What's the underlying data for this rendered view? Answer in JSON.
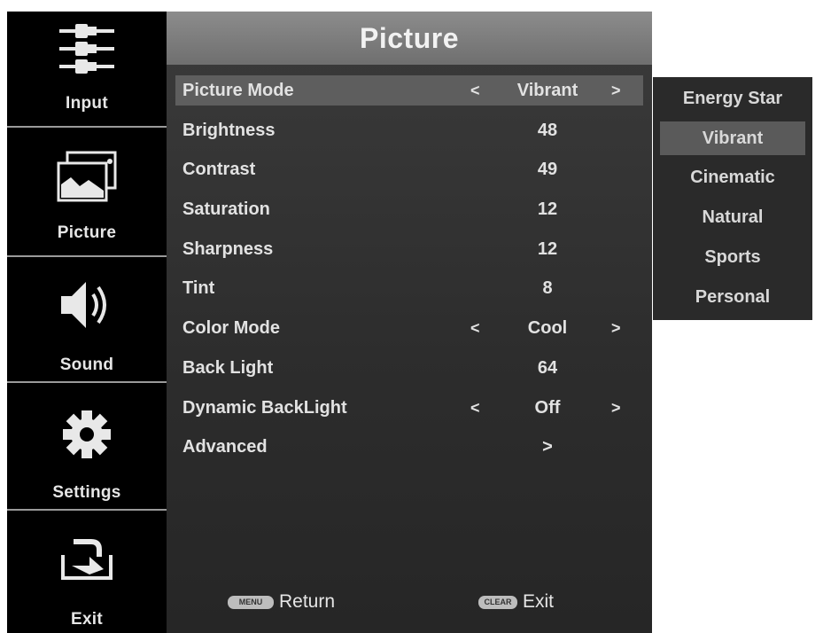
{
  "sidebar": {
    "items": [
      {
        "label": "Input",
        "icon": "input-cables-icon"
      },
      {
        "label": "Picture",
        "icon": "picture-icon"
      },
      {
        "label": "Sound",
        "icon": "speaker-icon"
      },
      {
        "label": "Settings",
        "icon": "gear-icon"
      },
      {
        "label": "Exit",
        "icon": "exit-arrow-icon"
      }
    ],
    "selected": "Picture"
  },
  "panel": {
    "title": "Picture",
    "rows": [
      {
        "label": "Picture Mode",
        "value": "Vibrant",
        "arrows": true,
        "selected": true
      },
      {
        "label": "Brightness",
        "value": "48"
      },
      {
        "label": "Contrast",
        "value": "49"
      },
      {
        "label": "Saturation",
        "value": "12"
      },
      {
        "label": "Sharpness",
        "value": "12"
      },
      {
        "label": "Tint",
        "value": "8"
      },
      {
        "label": "Color Mode",
        "value": "Cool",
        "arrows": true
      },
      {
        "label": "Back Light",
        "value": "64"
      },
      {
        "label": "Dynamic BackLight",
        "value": "Off",
        "arrows": true
      },
      {
        "label": "Advanced",
        "value": ">"
      }
    ],
    "arrow_left": "<",
    "arrow_right": ">"
  },
  "footer": {
    "return_button": "MENU",
    "return_label": "Return",
    "exit_button": "CLEAR",
    "exit_label": "Exit"
  },
  "dropdown": {
    "options": [
      "Energy Star",
      "Vibrant",
      "Cinematic",
      "Natural",
      "Sports",
      "Personal"
    ],
    "selected": "Vibrant"
  },
  "colors": {
    "sidebar_bg": "#000000",
    "panel_bg": "#333333",
    "title_bar": "#7d7d7d",
    "highlight": "#5e5e5e",
    "text": "#e2e2e2"
  }
}
